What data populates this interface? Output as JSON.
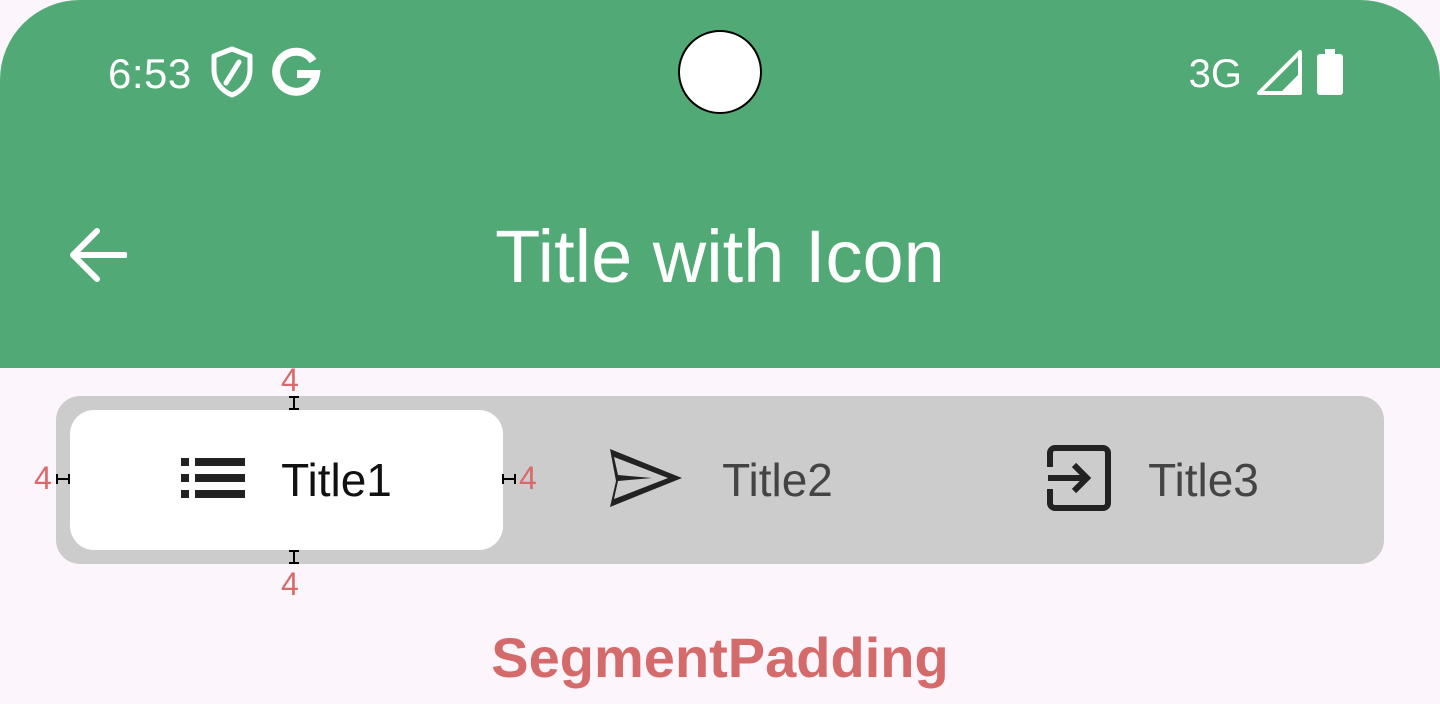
{
  "status_bar": {
    "time": "6:53",
    "network": "3G",
    "left_icons": [
      "shield-icon",
      "google-g-icon"
    ],
    "right_icons": [
      "signal-icon",
      "battery-icon"
    ]
  },
  "app_bar": {
    "title": "Title with Icon",
    "back_icon": "arrow-left-icon",
    "background": "#51aa75"
  },
  "segmented_control": {
    "segments": [
      {
        "label": "Title1",
        "icon": "list-icon",
        "selected": true
      },
      {
        "label": "Title2",
        "icon": "send-icon",
        "selected": false
      },
      {
        "label": "Title3",
        "icon": "exit-to-app-icon",
        "selected": false
      }
    ],
    "background": "#cccccc",
    "selected_background": "#ffffff"
  },
  "annotations": {
    "top": "4",
    "bottom": "4",
    "left": "4",
    "right": "4",
    "color": "#d96a6a"
  },
  "caption": "SegmentPadding"
}
